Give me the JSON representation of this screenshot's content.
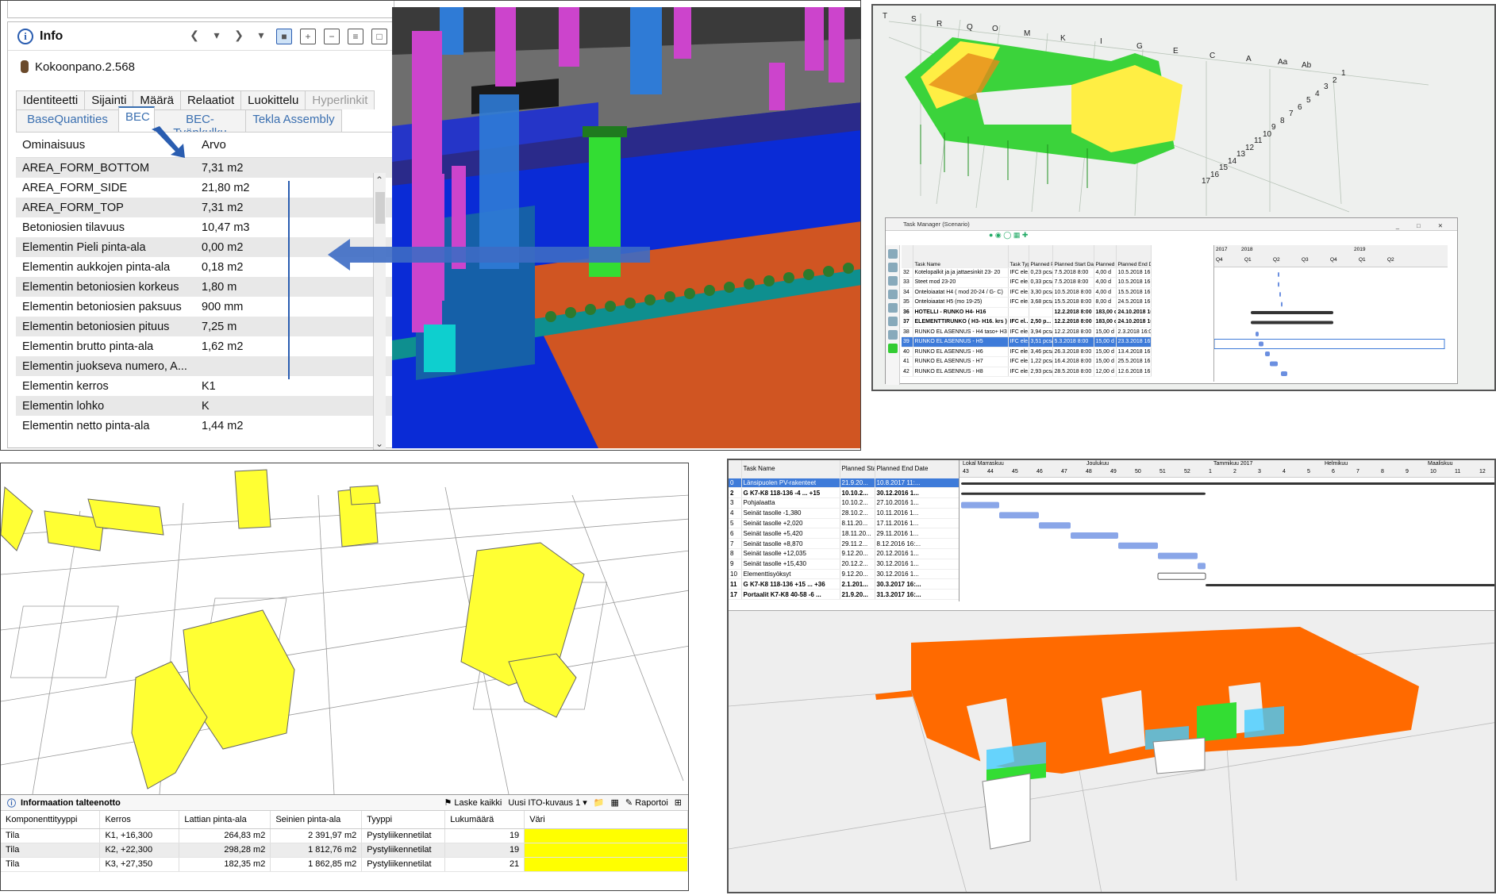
{
  "info_panel": {
    "title": "Info",
    "object_name": "Kokoonpano.2.568",
    "tabs_row1": [
      "Identiteetti",
      "Sijainti",
      "Määrä",
      "Relaatiot",
      "Luokittelu",
      "Hyperlinkit"
    ],
    "tabs_row2": [
      "BaseQuantities",
      "BEC",
      "BEC-Työnkulku",
      "Tekla Assembly"
    ],
    "selected_tab": "BEC",
    "columns": [
      "Ominaisuus",
      "Arvo"
    ],
    "rows": [
      {
        "name": "AREA_FORM_BOTTOM",
        "value": "7,31 m2"
      },
      {
        "name": "AREA_FORM_SIDE",
        "value": "21,80 m2"
      },
      {
        "name": "AREA_FORM_TOP",
        "value": "7,31 m2"
      },
      {
        "name": "Betoniosien tilavuus",
        "value": "10,47 m3"
      },
      {
        "name": "Elementin Pieli pinta-ala",
        "value": "0,00 m2"
      },
      {
        "name": "Elementin aukkojen pinta-ala",
        "value": "0,18 m2"
      },
      {
        "name": "Elementin betoniosien korkeus",
        "value": "1,80 m"
      },
      {
        "name": "Elementin betoniosien paksuus",
        "value": "900 mm"
      },
      {
        "name": "Elementin betoniosien pituus",
        "value": "7,25 m"
      },
      {
        "name": "Elementin brutto pinta-ala",
        "value": "1,62 m2"
      },
      {
        "name": "Elementin juokseva numero, A...",
        "value": ""
      },
      {
        "name": "Elementin kerros",
        "value": "K1"
      },
      {
        "name": "Elementin lohko",
        "value": "K"
      },
      {
        "name": "Elementin netto pinta-ala",
        "value": "1,44 m2"
      }
    ]
  },
  "grid_labels_top": [
    "T",
    "S",
    "R",
    "Q",
    "O",
    "M",
    "K",
    "I",
    "G",
    "E",
    "C",
    "A",
    "Aa",
    "Ab"
  ],
  "grid_labels_side": [
    "1",
    "2",
    "3",
    "4",
    "5",
    "6",
    "7",
    "8",
    "9",
    "10",
    "11",
    "12",
    "13",
    "14",
    "15",
    "16",
    "17"
  ],
  "task_manager": {
    "title": "Task Manager (Scenario)",
    "columns": [
      "",
      "Task Name",
      "Task Type",
      "Planned Production Rate",
      "Planned Start Date",
      "Planned Duration",
      "Planned End Dat"
    ],
    "years": [
      "2017",
      "2018",
      "2019"
    ],
    "quarters": [
      "Q4",
      "Q1",
      "Q2",
      "Q3",
      "Q4",
      "Q1",
      "Q2"
    ],
    "rows": [
      {
        "id": "32",
        "name": "Kotelopalkit ja ja jattaesinkit 23- 20",
        "type": "IFC ele...",
        "rate": "0,23 pcs/h",
        "start": "7.5.2018 8:00",
        "dur": "4,00 d",
        "end": "10.5.2018 16:00"
      },
      {
        "id": "33",
        "name": "Steet mod 23-20",
        "type": "IFC ele...",
        "rate": "0,33 pcs/h",
        "start": "7.5.2018 8:00",
        "dur": "4,00 d",
        "end": "10.5.2018 16:00"
      },
      {
        "id": "34",
        "name": "Onteloiaatat H4 ( mod 20-24 / G- C)",
        "type": "IFC ele...",
        "rate": "3,30 pcs/h",
        "start": "10.5.2018 8:00",
        "dur": "4,00 d",
        "end": "15.5.2018 16:00"
      },
      {
        "id": "35",
        "name": "Onteloiaatat H5 (mo 19-25)",
        "type": "IFC ele...",
        "rate": "3,68 pcs/h",
        "start": "15.5.2018 8:00",
        "dur": "8,00 d",
        "end": "24.5.2018 16:00"
      },
      {
        "id": "36",
        "name": "HOTELLI - RUNKO H4- H16",
        "type": "",
        "rate": "",
        "start": "12.2.2018 8:00",
        "dur": "183,00 d",
        "end": "24.10.2018 16",
        "bold": true
      },
      {
        "id": "37",
        "name": "ELEMENTTIRUNKO ( H3- H16. krs )",
        "type": "IFC el...",
        "rate": "2,50 p...",
        "start": "12.2.2018 8:00",
        "dur": "183,00 d",
        "end": "24.10.2018 16",
        "bold": true
      },
      {
        "id": "38",
        "name": "RUNKO EL ASENNUS - H4 taso+ H3 katto",
        "type": "IFC ele...",
        "rate": "3,94 pcs/h",
        "start": "12.2.2018 8:00",
        "dur": "15,00 d",
        "end": "2.3.2018 16:00"
      },
      {
        "id": "39",
        "name": "RUNKO EL ASENNUS - H5",
        "type": "IFC ele...",
        "rate": "3,51 pcs/h",
        "start": "5.3.2018 8:00",
        "dur": "15,00 d",
        "end": "23.3.2018 16:00",
        "sel": true
      },
      {
        "id": "40",
        "name": "RUNKO EL ASENNUS - H6",
        "type": "IFC ele...",
        "rate": "3,46 pcs/h",
        "start": "26.3.2018 8:00",
        "dur": "15,00 d",
        "end": "13.4.2018 16:00"
      },
      {
        "id": "41",
        "name": "RUNKO EL ASENNUS - H7",
        "type": "IFC ele...",
        "rate": "1,22 pcs/h",
        "start": "16.4.2018 8:00",
        "dur": "15,00 d",
        "end": "25.5.2018 16:00"
      },
      {
        "id": "42",
        "name": "RUNKO EL ASENNUS - H8",
        "type": "IFC ele...",
        "rate": "2,93 pcs/h",
        "start": "28.5.2018 8:00",
        "dur": "12,00 d",
        "end": "12.6.2018 16:00"
      }
    ]
  },
  "info_recovery": {
    "title": "Informaation talteenotto",
    "laske": "Laske kaikki",
    "ito": "Uusi ITO-kuvaus 1",
    "raportoi": "Raportoi",
    "columns": [
      "Komponenttityyppi",
      "Kerros",
      "Lattian pinta-ala",
      "Seinien pinta-ala",
      "Tyyppi",
      "Lukumäärä",
      "Väri"
    ],
    "rows": [
      {
        "comp": "Tila",
        "floor": "K1, +16,300",
        "floor_area": "264,83 m2",
        "wall_area": "2 391,97 m2",
        "type": "Pystyliikennetilat",
        "count": "19"
      },
      {
        "comp": "Tila",
        "floor": "K2, +22,300",
        "floor_area": "298,28 m2",
        "wall_area": "1 812,76 m2",
        "type": "Pystyliikennetilat",
        "count": "19"
      },
      {
        "comp": "Tila",
        "floor": "K3, +27,350",
        "floor_area": "182,35 m2",
        "wall_area": "1 862,85 m2",
        "type": "Pystyliikennetilat",
        "count": "21"
      }
    ]
  },
  "task_list": {
    "columns": [
      "",
      "Task Name",
      "Planned Start",
      "Planned End Date"
    ],
    "months": [
      "Lokal Marraskuu",
      "Joulukuu",
      "Tammikuu 2017",
      "Helmikuu",
      "Maaliskuu"
    ],
    "weeks": [
      "43",
      "44",
      "45",
      "46",
      "47",
      "48",
      "49",
      "50",
      "51",
      "52",
      "1",
      "2",
      "3",
      "4",
      "5",
      "6",
      "7",
      "8",
      "9",
      "10",
      "11",
      "12"
    ],
    "rows": [
      {
        "id": "0",
        "name": "Länsipuolen PV-rakenteet",
        "start": "21.9.20...",
        "end": "10.8.2017 11:...",
        "sel": true
      },
      {
        "id": "2",
        "name": "G K7-K8 118-136 -4 ... +15",
        "start": "10.10.2...",
        "end": "30.12.2016 1...",
        "bold": true
      },
      {
        "id": "3",
        "name": "Pohjalaatta",
        "start": "10.10.2...",
        "end": "27.10.2016 1..."
      },
      {
        "id": "4",
        "name": "Seinät tasolle -1,380",
        "start": "28.10.2...",
        "end": "10.11.2016 1..."
      },
      {
        "id": "5",
        "name": "Seinät tasolle +2,020",
        "start": "8.11.20...",
        "end": "17.11.2016 1..."
      },
      {
        "id": "6",
        "name": "Seinät tasolle +5,420",
        "start": "18.11.20...",
        "end": "29.11.2016 1..."
      },
      {
        "id": "7",
        "name": "Seinät tasolle +8,870",
        "start": "29.11.2...",
        "end": "8.12.2016 16:..."
      },
      {
        "id": "8",
        "name": "Seinät tasolle +12,035",
        "start": "9.12.20...",
        "end": "20.12.2016 1..."
      },
      {
        "id": "9",
        "name": "Seinät tasolle +15,430",
        "start": "20.12.2...",
        "end": "30.12.2016 1..."
      },
      {
        "id": "10",
        "name": "Elementtisyöksyt",
        "start": "9.12.20...",
        "end": "30.12.2016 1..."
      },
      {
        "id": "11",
        "name": "G K7-K8 118-136 +15 ... +36",
        "start": "2.1.201...",
        "end": "30.3.2017 16:...",
        "bold": true
      },
      {
        "id": "17",
        "name": "Portaalit K7-K8 40-58 -6 ...",
        "start": "21.9.20...",
        "end": "31.3.2017 16:...",
        "bold": true
      }
    ]
  },
  "colors": {
    "accent": "#2a5db0",
    "selection": "#3e7bd9",
    "yellow": "#ffff00",
    "orange": "#ff6a00",
    "green": "#33dd33",
    "magenta": "#cc44cc"
  }
}
